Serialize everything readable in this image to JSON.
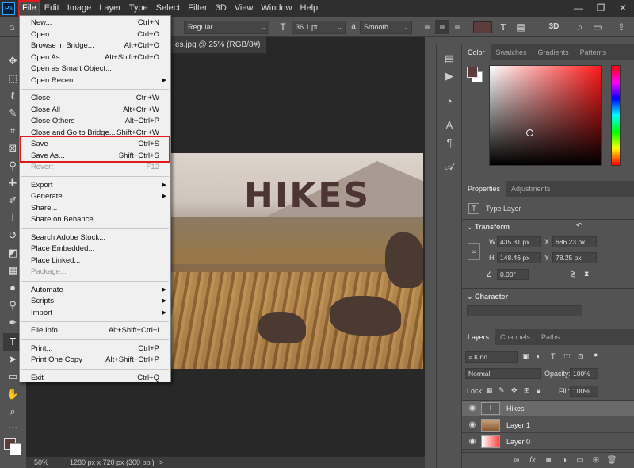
{
  "app": {
    "logo": "Ps"
  },
  "menubar": {
    "items": [
      "File",
      "Edit",
      "Image",
      "Layer",
      "Type",
      "Select",
      "Filter",
      "3D",
      "View",
      "Window",
      "Help"
    ],
    "window_controls": [
      "—",
      "❐",
      "✕"
    ]
  },
  "options_bar": {
    "font_style": "Regular",
    "font_size": "36.1 pt",
    "antialias": "Smooth",
    "color": "#5c3d3c",
    "aa_prefix": "a",
    "icons": [
      "move-icon",
      "text-orientation-icon",
      "font-size-icon",
      "align-left-icon",
      "align-center-icon",
      "align-right-icon",
      "warp-text-icon",
      "character-panel-icon",
      "3d-icon",
      "search-icon",
      "workspace-icon",
      "share-icon"
    ]
  },
  "document": {
    "tab_title": "es.jpg @ 25% (RGB/8#)",
    "image_text": "HIKES",
    "zoom": "50%",
    "info": "1280 px x 720 px (300 ppi)",
    "status_arrow": ">"
  },
  "file_menu": {
    "groups": [
      [
        {
          "label": "New...",
          "shortcut": "Ctrl+N"
        },
        {
          "label": "Open...",
          "shortcut": "Ctrl+O"
        },
        {
          "label": "Browse in Bridge...",
          "shortcut": "Alt+Ctrl+O"
        },
        {
          "label": "Open As...",
          "shortcut": "Alt+Shift+Ctrl+O"
        },
        {
          "label": "Open as Smart Object...",
          "shortcut": ""
        },
        {
          "label": "Open Recent",
          "shortcut": "",
          "submenu": true
        }
      ],
      [
        {
          "label": "Close",
          "shortcut": "Ctrl+W"
        },
        {
          "label": "Close All",
          "shortcut": "Alt+Ctrl+W"
        },
        {
          "label": "Close Others",
          "shortcut": "Alt+Ctrl+P"
        },
        {
          "label": "Close and Go to Bridge...",
          "shortcut": "Shift+Ctrl+W"
        },
        {
          "label": "Save",
          "shortcut": "Ctrl+S"
        },
        {
          "label": "Save As...",
          "shortcut": "Shift+Ctrl+S"
        },
        {
          "label": "Revert",
          "shortcut": "F12",
          "disabled": true
        }
      ],
      [
        {
          "label": "Export",
          "shortcut": "",
          "submenu": true
        },
        {
          "label": "Generate",
          "shortcut": "",
          "submenu": true
        },
        {
          "label": "Share...",
          "shortcut": ""
        },
        {
          "label": "Share on Behance...",
          "shortcut": ""
        }
      ],
      [
        {
          "label": "Search Adobe Stock...",
          "shortcut": ""
        },
        {
          "label": "Place Embedded...",
          "shortcut": ""
        },
        {
          "label": "Place Linked...",
          "shortcut": ""
        },
        {
          "label": "Package...",
          "shortcut": "",
          "disabled": true
        }
      ],
      [
        {
          "label": "Automate",
          "shortcut": "",
          "submenu": true
        },
        {
          "label": "Scripts",
          "shortcut": "",
          "submenu": true
        },
        {
          "label": "Import",
          "shortcut": "",
          "submenu": true
        }
      ],
      [
        {
          "label": "File Info...",
          "shortcut": "Alt+Shift+Ctrl+I"
        }
      ],
      [
        {
          "label": "Print...",
          "shortcut": "Ctrl+P"
        },
        {
          "label": "Print One Copy",
          "shortcut": "Alt+Shift+Ctrl+P"
        }
      ],
      [
        {
          "label": "Exit",
          "shortcut": "Ctrl+Q"
        }
      ]
    ]
  },
  "color_panel": {
    "tabs": [
      "Color",
      "Swatches",
      "Gradients",
      "Patterns"
    ],
    "active_tab": "Color"
  },
  "properties_panel": {
    "tabs": [
      "Properties",
      "Adjustments"
    ],
    "layer_type": "Type Layer",
    "transform_title": "Transform",
    "w_label": "W",
    "w_value": "435.31 px",
    "x_label": "X",
    "x_value": "686.23 px",
    "h_label": "H",
    "h_value": "148.46 px",
    "y_label": "Y",
    "y_value": "78.25 px",
    "angle_value": "0.00°",
    "character_title": "Character"
  },
  "layers_panel": {
    "tabs": [
      "Layers",
      "Channels",
      "Paths"
    ],
    "filter": "Kind",
    "blend_mode": "Normal",
    "opacity_label": "Opacity:",
    "opacity": "100%",
    "lock_label": "Lock:",
    "fill_label": "Fill:",
    "fill": "100%",
    "layers": [
      {
        "name": "Hikes",
        "type": "text",
        "thumb": "T"
      },
      {
        "name": "Layer 1",
        "type": "image"
      },
      {
        "name": "Layer 0",
        "type": "image"
      }
    ],
    "footer_icons": [
      "link-icon",
      "fx-icon",
      "mask-icon",
      "adjustment-icon",
      "group-icon",
      "new-layer-icon",
      "trash-icon"
    ]
  },
  "colors": {
    "foreground": "#5c3d3c",
    "accent_highlight": "#e01b1b"
  }
}
